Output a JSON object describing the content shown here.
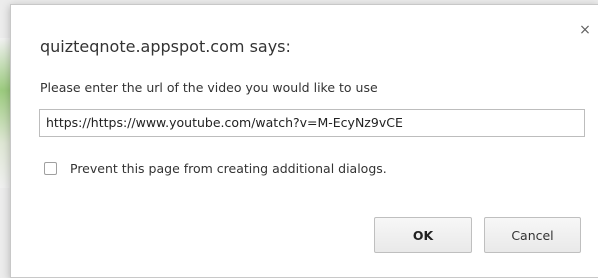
{
  "dialog": {
    "title": "quizteqnote.appspot.com says:",
    "message": "Please enter the url of the video you would like to use",
    "input_value": "https://https://www.youtube.com/watch?v=M-EcyNz9vCE",
    "checkbox_label": "Prevent this page from creating additional dialogs.",
    "ok_label": "OK",
    "cancel_label": "Cancel",
    "close_glyph": "×"
  }
}
